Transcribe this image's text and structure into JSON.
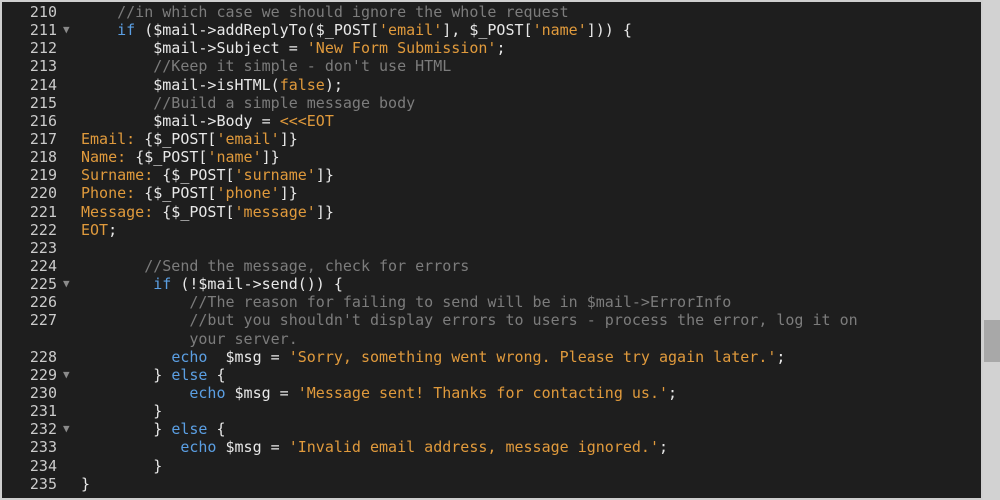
{
  "editor": {
    "language": "PHP",
    "lines": [
      {
        "num": "210",
        "fold": false,
        "segments": [
          {
            "t": "    ",
            "k": "plain"
          },
          {
            "t": "//in which case we should ignore the whole request",
            "k": "comment"
          }
        ]
      },
      {
        "num": "211",
        "fold": true,
        "segments": [
          {
            "t": "    ",
            "k": "plain"
          },
          {
            "t": "if",
            "k": "keyword"
          },
          {
            "t": " ($mail->addReplyTo($_POST[",
            "k": "plain"
          },
          {
            "t": "'email'",
            "k": "string"
          },
          {
            "t": "], $_POST[",
            "k": "plain"
          },
          {
            "t": "'name'",
            "k": "string"
          },
          {
            "t": "])) {",
            "k": "plain"
          }
        ]
      },
      {
        "num": "212",
        "fold": false,
        "segments": [
          {
            "t": "        $mail->Subject = ",
            "k": "plain"
          },
          {
            "t": "'New Form Submission'",
            "k": "string"
          },
          {
            "t": ";",
            "k": "plain"
          }
        ]
      },
      {
        "num": "213",
        "fold": false,
        "segments": [
          {
            "t": "        ",
            "k": "plain"
          },
          {
            "t": "//Keep it simple - don't use HTML",
            "k": "comment"
          }
        ]
      },
      {
        "num": "214",
        "fold": false,
        "segments": [
          {
            "t": "        $mail->isHTML(",
            "k": "plain"
          },
          {
            "t": "false",
            "k": "bool"
          },
          {
            "t": ");",
            "k": "plain"
          }
        ]
      },
      {
        "num": "215",
        "fold": false,
        "segments": [
          {
            "t": "        ",
            "k": "plain"
          },
          {
            "t": "//Build a simple message body",
            "k": "comment"
          }
        ]
      },
      {
        "num": "216",
        "fold": false,
        "segments": [
          {
            "t": "        $mail->Body = ",
            "k": "plain"
          },
          {
            "t": "<<<EOT",
            "k": "heredoc"
          }
        ]
      },
      {
        "num": "217",
        "fold": false,
        "segments": [
          {
            "t": "Email: ",
            "k": "heredoc"
          },
          {
            "t": "{$_POST[",
            "k": "plain"
          },
          {
            "t": "'email'",
            "k": "string"
          },
          {
            "t": "]}",
            "k": "plain"
          }
        ]
      },
      {
        "num": "218",
        "fold": false,
        "segments": [
          {
            "t": "Name: ",
            "k": "heredoc"
          },
          {
            "t": "{$_POST[",
            "k": "plain"
          },
          {
            "t": "'name'",
            "k": "string"
          },
          {
            "t": "]}",
            "k": "plain"
          }
        ]
      },
      {
        "num": "219",
        "fold": false,
        "segments": [
          {
            "t": "Surname: ",
            "k": "heredoc"
          },
          {
            "t": "{$_POST[",
            "k": "plain"
          },
          {
            "t": "'surname'",
            "k": "string"
          },
          {
            "t": "]}",
            "k": "plain"
          }
        ]
      },
      {
        "num": "220",
        "fold": false,
        "segments": [
          {
            "t": "Phone: ",
            "k": "heredoc"
          },
          {
            "t": "{$_POST[",
            "k": "plain"
          },
          {
            "t": "'phone'",
            "k": "string"
          },
          {
            "t": "]}",
            "k": "plain"
          }
        ]
      },
      {
        "num": "221",
        "fold": false,
        "segments": [
          {
            "t": "Message: ",
            "k": "heredoc"
          },
          {
            "t": "{$_POST[",
            "k": "plain"
          },
          {
            "t": "'message'",
            "k": "string"
          },
          {
            "t": "]}",
            "k": "plain"
          }
        ]
      },
      {
        "num": "222",
        "fold": false,
        "segments": [
          {
            "t": "EOT",
            "k": "heredoc"
          },
          {
            "t": ";",
            "k": "plain"
          }
        ]
      },
      {
        "num": "223",
        "fold": false,
        "segments": []
      },
      {
        "num": "224",
        "fold": false,
        "segments": [
          {
            "t": "       ",
            "k": "plain"
          },
          {
            "t": "//Send the message, check for errors",
            "k": "comment"
          }
        ]
      },
      {
        "num": "225",
        "fold": true,
        "segments": [
          {
            "t": "        ",
            "k": "plain"
          },
          {
            "t": "if",
            "k": "keyword"
          },
          {
            "t": " (!$mail->send()) {",
            "k": "plain"
          }
        ]
      },
      {
        "num": "226",
        "fold": false,
        "segments": [
          {
            "t": "            ",
            "k": "plain"
          },
          {
            "t": "//The reason for failing to send will be in $mail->ErrorInfo",
            "k": "comment"
          }
        ]
      },
      {
        "num": "227",
        "fold": false,
        "wrap": true,
        "segments": [
          {
            "t": "            ",
            "k": "plain"
          },
          {
            "t": "//but you shouldn't display errors to users - process the error, log it on",
            "k": "comment"
          }
        ],
        "continuation": [
          {
            "t": "            ",
            "k": "plain"
          },
          {
            "t": "your server.",
            "k": "comment"
          }
        ]
      },
      {
        "num": "228",
        "fold": false,
        "segments": [
          {
            "t": "          ",
            "k": "plain"
          },
          {
            "t": "echo",
            "k": "keyword"
          },
          {
            "t": "  $msg = ",
            "k": "plain"
          },
          {
            "t": "'Sorry, something went wrong. Please try again later.'",
            "k": "string"
          },
          {
            "t": ";",
            "k": "plain"
          }
        ]
      },
      {
        "num": "229",
        "fold": true,
        "segments": [
          {
            "t": "        } ",
            "k": "plain"
          },
          {
            "t": "else",
            "k": "keyword"
          },
          {
            "t": " {",
            "k": "plain"
          }
        ]
      },
      {
        "num": "230",
        "fold": false,
        "segments": [
          {
            "t": "            ",
            "k": "plain"
          },
          {
            "t": "echo",
            "k": "keyword"
          },
          {
            "t": " $msg = ",
            "k": "plain"
          },
          {
            "t": "'Message sent! Thanks for contacting us.'",
            "k": "string"
          },
          {
            "t": ";",
            "k": "plain"
          }
        ]
      },
      {
        "num": "231",
        "fold": false,
        "segments": [
          {
            "t": "        }",
            "k": "plain"
          }
        ]
      },
      {
        "num": "232",
        "fold": true,
        "segments": [
          {
            "t": "        } ",
            "k": "plain"
          },
          {
            "t": "else",
            "k": "keyword"
          },
          {
            "t": " {",
            "k": "plain"
          }
        ]
      },
      {
        "num": "233",
        "fold": false,
        "segments": [
          {
            "t": "           ",
            "k": "plain"
          },
          {
            "t": "echo",
            "k": "keyword"
          },
          {
            "t": " $msg = ",
            "k": "plain"
          },
          {
            "t": "'Invalid email address, message ignored.'",
            "k": "string"
          },
          {
            "t": ";",
            "k": "plain"
          }
        ]
      },
      {
        "num": "234",
        "fold": false,
        "segments": [
          {
            "t": "        }",
            "k": "plain"
          }
        ]
      },
      {
        "num": "235",
        "fold": false,
        "segments": [
          {
            "t": "}",
            "k": "plain"
          }
        ]
      }
    ]
  },
  "fold_glyph": "▼",
  "colors": {
    "background": "#1e1e1e",
    "line_number": "#cbcbcb",
    "comment": "#7c7c7c",
    "string": "#e09a3c",
    "keyword": "#5b9fe3",
    "plain": "#e8e8e8",
    "scrollbar_track": "#d2d2d2",
    "scrollbar_thumb": "#a8a8a8"
  }
}
